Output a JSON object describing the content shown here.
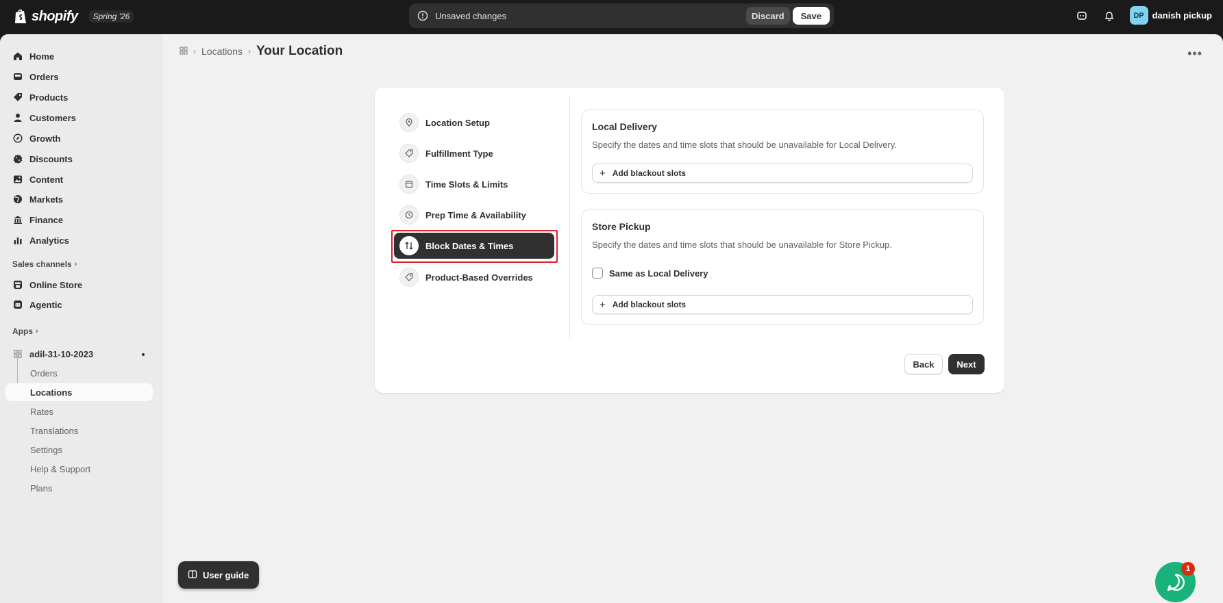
{
  "topbar": {
    "brand": "shopify",
    "edition": "Spring '26",
    "unsaved_text": "Unsaved changes",
    "discard_label": "Discard",
    "save_label": "Save",
    "user_initials": "DP",
    "user_name": "danish pickup"
  },
  "sidebar": {
    "nav": [
      {
        "label": "Home",
        "icon": "home-icon"
      },
      {
        "label": "Orders",
        "icon": "inbox-icon"
      },
      {
        "label": "Products",
        "icon": "tag-icon"
      },
      {
        "label": "Customers",
        "icon": "person-icon"
      },
      {
        "label": "Growth",
        "icon": "compass-icon"
      },
      {
        "label": "Discounts",
        "icon": "discount-icon"
      },
      {
        "label": "Content",
        "icon": "image-icon"
      },
      {
        "label": "Markets",
        "icon": "globe-icon"
      },
      {
        "label": "Finance",
        "icon": "bank-icon"
      },
      {
        "label": "Analytics",
        "icon": "bar-chart-icon"
      }
    ],
    "sales_channels_label": "Sales channels",
    "channels": [
      {
        "label": "Online Store",
        "icon": "store-icon"
      },
      {
        "label": "Agentic",
        "icon": "agentic-icon"
      }
    ],
    "apps_label": "Apps",
    "app_name": "adil-31-10-2023",
    "app_sub_items": [
      "Orders",
      "Locations",
      "Rates",
      "Translations",
      "Settings",
      "Help & Support",
      "Plans"
    ],
    "user_guide_label": "User guide"
  },
  "header": {
    "breadcrumb_parent": "Locations",
    "title": "Your Location"
  },
  "steps": [
    {
      "label": "Location Setup",
      "icon": "location-pin-icon"
    },
    {
      "label": "Fulfillment Type",
      "icon": "tag-icon"
    },
    {
      "label": "Time Slots & Limits",
      "icon": "calendar-icon"
    },
    {
      "label": "Prep Time & Availability",
      "icon": "clock-icon"
    },
    {
      "label": "Block Dates & Times",
      "icon": "arrows-swap-icon",
      "active": true
    },
    {
      "label": "Product-Based Overrides",
      "icon": "tag-icon"
    }
  ],
  "local_delivery": {
    "title": "Local Delivery",
    "description": "Specify the dates and time slots that should be unavailable for Local Delivery.",
    "add_label": "Add blackout slots"
  },
  "store_pickup": {
    "title": "Store Pickup",
    "description": "Specify the dates and time slots that should be unavailable for Store Pickup.",
    "checkbox_label": "Same as Local Delivery",
    "checkbox_checked": false,
    "add_label": "Add blackout slots"
  },
  "actions": {
    "back_label": "Back",
    "next_label": "Next"
  },
  "chat": {
    "badge_count": "1"
  },
  "colors": {
    "topbar": "#1a1a1a",
    "primary_button": "#303030",
    "highlight": "#e0202a",
    "chat": "#18b27a"
  }
}
